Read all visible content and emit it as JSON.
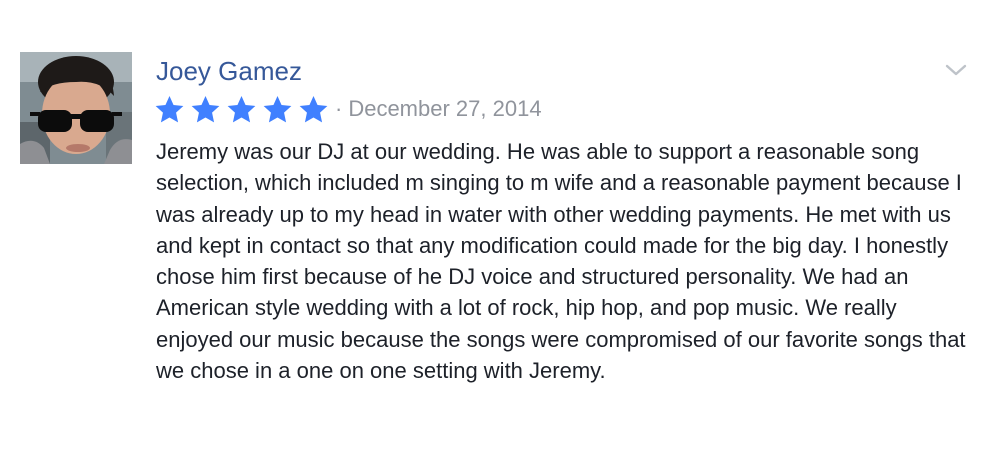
{
  "review": {
    "author_name": "Joey Gamez",
    "rating": 5,
    "rating_max": 5,
    "separator": "·",
    "date": "December 27, 2014",
    "text": "Jeremy was our DJ at our wedding. He was able to support a reasonable song selection, which included m singing to m wife and a reasonable payment because I was already up to my head in water with other wedding payments. He met with us and kept in contact so that any modification could made for the big day. I honestly chose him first because of he DJ voice and structured personality. We had an American style wedding with a lot of rock, hip hop, and pop music. We really enjoyed our music because the songs were compromised of our favorite songs that we chose in a one on one setting with Jeremy."
  },
  "colors": {
    "author_link": "#365899",
    "star": "#4080ff",
    "meta_gray": "#90949c",
    "body_text": "#1d2129",
    "chevron": "#bec3c9"
  },
  "icons": {
    "star": "star-icon",
    "options": "chevron-down-icon",
    "avatar": "user-avatar-photo"
  }
}
